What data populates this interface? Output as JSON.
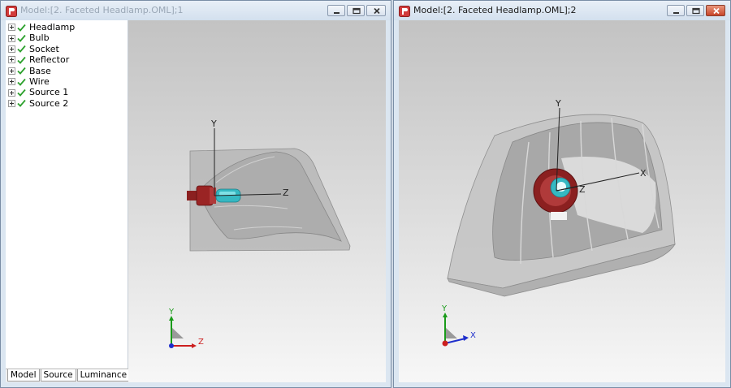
{
  "windows": [
    {
      "title": "Model:[2. Faceted Headlamp.OML];1",
      "tree": [
        "Headlamp",
        "Bulb",
        "Socket",
        "Reflector",
        "Base",
        "Wire",
        "Source 1",
        "Source 2"
      ],
      "tabs": [
        "Model",
        "Source",
        "Luminance"
      ],
      "scene_axes": {
        "y": "Y",
        "z": "Z"
      },
      "triad": {
        "y": "Y",
        "z": "Z"
      }
    },
    {
      "title": "Model:[2. Faceted Headlamp.OML];2",
      "scene_axes": {
        "y": "Y",
        "x": "X",
        "z": "Z"
      },
      "triad": {
        "y": "Y",
        "x": "X"
      }
    }
  ],
  "icons": {
    "app": "app-logo-icon",
    "minimize": "minimize-icon",
    "maximize": "maximize-icon",
    "close": "close-icon",
    "expand": "expander-plus-icon",
    "visible": "green-check-icon"
  },
  "colors": {
    "check": "#2da12d",
    "axis_y": "#1a9b1a",
    "axis_z": "#cc1f1f",
    "axis_x": "#1f2fcc",
    "socket": "#8b2020",
    "bulb": "#35b8c2"
  }
}
